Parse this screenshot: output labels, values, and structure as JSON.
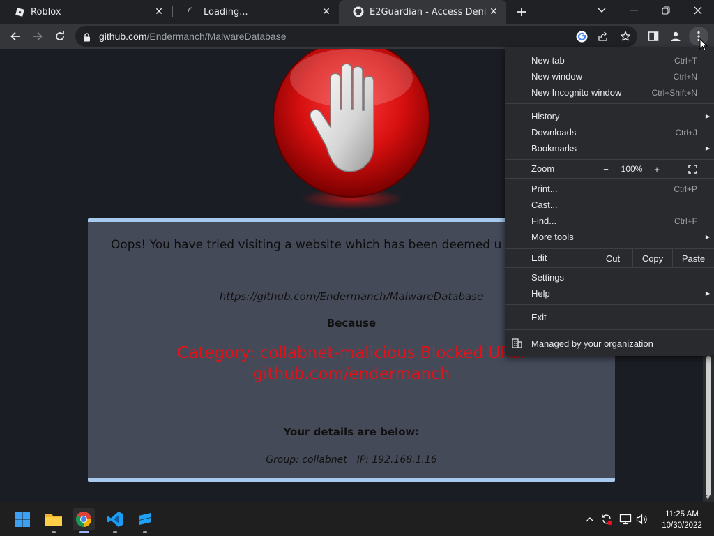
{
  "tabs": [
    {
      "title": "Roblox",
      "icon": "roblox-icon",
      "active": false
    },
    {
      "title": "Loading...",
      "icon": "loading-spinner-icon",
      "active": false
    },
    {
      "title": "E2Guardian - Access Denied",
      "icon": "github-icon",
      "active": true
    }
  ],
  "address_bar": {
    "host": "github.com",
    "path": "/Endermanch/MalwareDatabase"
  },
  "page": {
    "headline": "Oops! You have tried visiting a website which has been deemed u",
    "blocked_url": "https://github.com/Endermanch/MalwareDatabase",
    "because_label": "Because",
    "reason": "Category: collabnet-malicious  Blocked URL: github.com/endermanch",
    "details_heading": "Your details are below:",
    "group": "Group: collabnet",
    "ip": "IP: 192.168.1.16"
  },
  "menu": {
    "new_tab": {
      "label": "New tab",
      "shortcut": "Ctrl+T"
    },
    "new_window": {
      "label": "New window",
      "shortcut": "Ctrl+N"
    },
    "new_incognito": {
      "label": "New Incognito window",
      "shortcut": "Ctrl+Shift+N"
    },
    "history": {
      "label": "History"
    },
    "downloads": {
      "label": "Downloads",
      "shortcut": "Ctrl+J"
    },
    "bookmarks": {
      "label": "Bookmarks"
    },
    "zoom": {
      "label": "Zoom",
      "minus": "−",
      "level": "100%",
      "plus": "+"
    },
    "print": {
      "label": "Print...",
      "shortcut": "Ctrl+P"
    },
    "cast": {
      "label": "Cast..."
    },
    "find": {
      "label": "Find...",
      "shortcut": "Ctrl+F"
    },
    "more_tools": {
      "label": "More tools"
    },
    "edit": {
      "label": "Edit",
      "cut": "Cut",
      "copy": "Copy",
      "paste": "Paste"
    },
    "settings": {
      "label": "Settings"
    },
    "help": {
      "label": "Help"
    },
    "exit": {
      "label": "Exit"
    },
    "managed": {
      "label": "Managed by your organization"
    }
  },
  "taskbar": {
    "apps": [
      "start-icon",
      "file-explorer-icon",
      "chrome-icon",
      "vscode-icon",
      "roblox-studio-icon"
    ],
    "time": "11:25 AM",
    "date": "10/30/2022"
  },
  "colors": {
    "panel_bg": "#454a59",
    "panel_border": "#a7c9ee",
    "reason_text": "#e0131a",
    "page_bg": "#1b1d24",
    "menu_bg": "#292a2d"
  }
}
